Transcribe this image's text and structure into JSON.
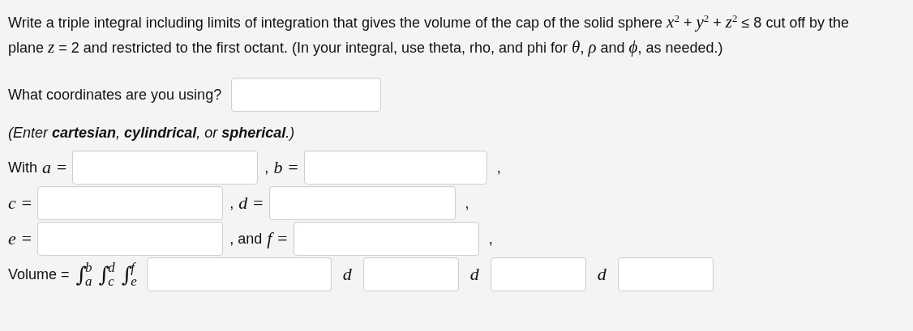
{
  "problem": "Write a triple integral including limits of integration that gives the volume of the cap of the solid sphere *x*$^{2}$ + *y*$^{2}$ + *z*$^{2}$ ≤ 8 cut off by the plane *z* = 2 and restricted to the first octant. (In your integral, use theta, rho, and phi for *θ*, *ρ* and *ϕ*, as needed.)",
  "coordinates": {
    "question": "What coordinates are you using?",
    "hint": "(Enter **cartesian**, **cylindrical**, or **spherical**.)"
  },
  "limit_rows": [
    {
      "items": [
        {
          "before": "With",
          "symbol": "a ="
        },
        {
          "before": ",",
          "symbol": "b ="
        }
      ],
      "after": ","
    },
    {
      "items": [
        {
          "symbol": "c ="
        },
        {
          "before": ",",
          "symbol": "d ="
        }
      ],
      "after": ","
    },
    {
      "items": [
        {
          "symbol": "e ="
        },
        {
          "before": ", and",
          "symbol": "f ="
        }
      ],
      "after": ","
    }
  ],
  "volume": {
    "label": "Volume =",
    "integrals": [
      {
        "sign": "∫",
        "upper": "b",
        "lower": "a"
      },
      {
        "sign": "∫",
        "upper": "d",
        "lower": "c"
      },
      {
        "sign": "∫",
        "upper": "f",
        "lower": "e"
      }
    ],
    "differentials": [
      "d",
      "d",
      "d"
    ]
  }
}
